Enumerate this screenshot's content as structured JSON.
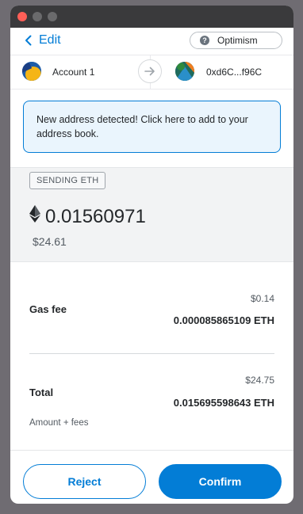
{
  "header": {
    "back_label": "Edit",
    "network_label": "Optimism",
    "network_help_glyph": "?"
  },
  "accounts": {
    "from_name": "Account 1",
    "to_address": "0xd6C...f96C"
  },
  "notice": {
    "text": "New address detected! Click here to add to your address book."
  },
  "sending": {
    "badge": "SENDING ETH",
    "amount": "0.01560971",
    "fiat": "$24.61"
  },
  "gas_fee": {
    "label": "Gas fee",
    "fiat": "$0.14",
    "eth": "0.000085865109 ETH"
  },
  "total": {
    "label": "Total",
    "fiat": "$24.75",
    "eth": "0.015695598643 ETH",
    "note": "Amount + fees"
  },
  "footer": {
    "reject_label": "Reject",
    "confirm_label": "Confirm"
  },
  "colors": {
    "accent": "#037dd6",
    "notice_bg": "#eaf5fd",
    "panel_bg": "#f2f3f4"
  },
  "icons": {
    "back": "chevron-left-icon",
    "arrow": "arrow-right-icon",
    "eth": "ethereum-icon"
  }
}
